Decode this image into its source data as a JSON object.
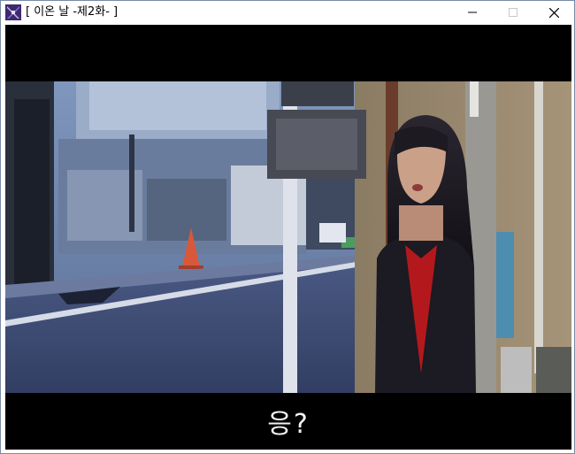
{
  "window": {
    "title": "[ 이온 날 -제2화- ]",
    "icon": "sword-app-icon"
  },
  "controls": {
    "minimize": "minimize-icon",
    "maximize": "maximize-icon",
    "close": "close-icon"
  },
  "dialog": {
    "text": "응?"
  },
  "colors": {
    "window_border": "#7a8aa6",
    "game_bg": "#000000",
    "dialog_text": "#f2f2f2",
    "scarf_red": "#b3191c"
  }
}
